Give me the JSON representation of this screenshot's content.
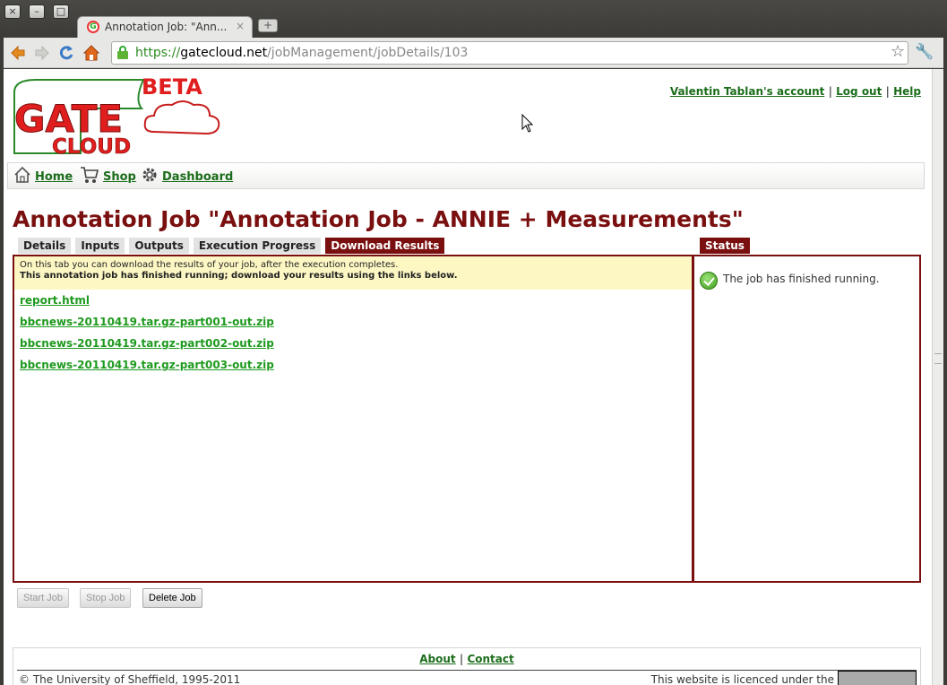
{
  "browser": {
    "tab_title": "Annotation Job: \"Ann...",
    "tab_close": "×",
    "new_tab": "+",
    "url_scheme": "https://",
    "url_host": "gatecloud.net",
    "url_path": "/jobManagement/jobDetails/103",
    "window_buttons": [
      "×",
      "–",
      "□"
    ]
  },
  "header": {
    "logo_text": {
      "beta": "BETA",
      "gate": "GATE",
      "cloud": "CLOUD"
    },
    "account_link": "Valentin Tablan's account",
    "logout_link": "Log out",
    "help_link": "Help",
    "separator": "|"
  },
  "nav": {
    "home": "Home",
    "shop": "Shop",
    "dashboard": "Dashboard"
  },
  "page": {
    "title": "Annotation Job \"Annotation Job - ANNIE + Measurements\""
  },
  "tabs": [
    "Details",
    "Inputs",
    "Outputs",
    "Execution Progress",
    "Download Results"
  ],
  "active_tab": "Download Results",
  "notice": {
    "line1": "On this tab you can download the results of your job, after the execution completes.",
    "line2": "This annotation job has finished running; download your results using the links below."
  },
  "files": [
    "report.html",
    "bbcnews-20110419.tar.gz-part001-out.zip",
    "bbcnews-20110419.tar.gz-part002-out.zip",
    "bbcnews-20110419.tar.gz-part003-out.zip"
  ],
  "status": {
    "tab_label": "Status",
    "message": "The job has finished running."
  },
  "buttons": {
    "start": "Start Job",
    "stop": "Stop Job",
    "delete": "Delete Job"
  },
  "footer": {
    "about": "About",
    "contact": "Contact",
    "separator": "|",
    "copyright": "© The University of Sheffield, 1995-2011",
    "licence": "This website is licenced under the"
  },
  "colors": {
    "brand_red": "#7a0f0f",
    "link_green": "#1b6d1b",
    "file_green": "#1f9a1f",
    "notice_bg": "#fdf7c4"
  },
  "icons": [
    "close-icon",
    "minimize-icon",
    "maximize-icon",
    "back-icon",
    "forward-icon",
    "reload-icon",
    "home-icon",
    "lock-icon",
    "star-icon",
    "wrench-icon",
    "house-icon",
    "cart-icon",
    "gear-icon",
    "check-icon"
  ]
}
